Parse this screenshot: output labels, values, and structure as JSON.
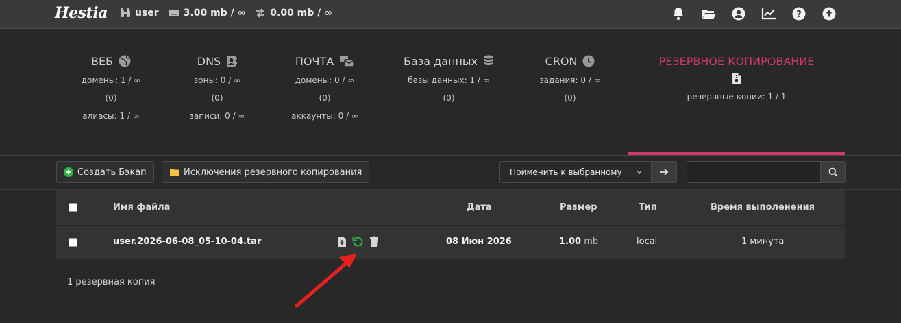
{
  "topbar": {
    "logo": "Hestia",
    "user": "user",
    "disk": "3.00 mb / ∞",
    "bandwidth": "0.00 mb / ∞"
  },
  "stats": [
    {
      "title": "ВЕБ",
      "lines": [
        "домены: 1 / ∞",
        "(0)",
        "алиасы: 1 / ∞"
      ]
    },
    {
      "title": "DNS",
      "lines": [
        "зоны: 0 / ∞",
        "(0)",
        "записи: 0 / ∞"
      ]
    },
    {
      "title": "ПОЧТА",
      "lines": [
        "домены: 0 / ∞",
        "(0)",
        "аккаунты: 0 / ∞"
      ]
    },
    {
      "title": "База данных",
      "lines": [
        "базы данных: 1 / ∞",
        "(0)"
      ]
    },
    {
      "title": "CRON",
      "lines": [
        "задания: 0 / ∞",
        "(0)"
      ]
    },
    {
      "title": "РЕЗЕРВНОЕ КОПИРОВАНИЕ",
      "lines": [
        "резервные копии: 1 / 1"
      ]
    }
  ],
  "toolbar": {
    "create_backup": "Создать Бэкап",
    "exclusions": "Исключения резервного копирования",
    "bulk_action": "Применить к выбранному"
  },
  "table": {
    "headers": [
      "Имя файла",
      "Дата",
      "Размер",
      "Тип",
      "Время выполенения"
    ],
    "rows": [
      {
        "filename": "user.2026-06-08_05-10-04.tar",
        "date": "08 Июн 2026",
        "size": "1.00",
        "size_unit": "mb",
        "type": "local",
        "runtime": "1 минута"
      }
    ]
  },
  "footer": "1 резервная копия",
  "colors": {
    "accent": "#d1386c",
    "green": "#2fb344",
    "folder": "#f6c342",
    "arrow": "#e8201f"
  }
}
